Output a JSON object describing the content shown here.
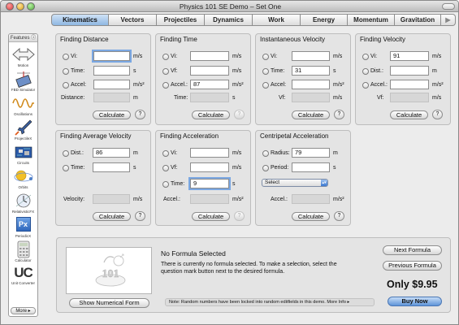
{
  "window": {
    "title": "Physics 101 SE Demo – Set One"
  },
  "tabs": [
    {
      "label": "Kinematics",
      "active": true
    },
    {
      "label": "Vectors"
    },
    {
      "label": "Projectiles"
    },
    {
      "label": "Dynamics"
    },
    {
      "label": "Work"
    },
    {
      "label": "Energy"
    },
    {
      "label": "Momentum"
    },
    {
      "label": "Gravitation"
    }
  ],
  "tab_scroll_glyph": "▶",
  "sidebar": {
    "header": "Features ⓘ",
    "items": [
      {
        "label": "Motion",
        "icon": "motion-arrows-icon"
      },
      {
        "label": "FBD Simulator",
        "icon": "fbd-simulator-icon"
      },
      {
        "label": "Oscillations",
        "icon": "oscillations-icon"
      },
      {
        "label": "ProjectileX",
        "icon": "rocket-icon"
      },
      {
        "label": "Circuits",
        "icon": "circuit-board-icon"
      },
      {
        "label": "Orbits",
        "icon": "orbits-icon"
      },
      {
        "label": "RelativisticFX",
        "icon": "relativistic-icon"
      },
      {
        "label": "PeriodicX",
        "icon": "periodic-icon",
        "badge": "Px"
      },
      {
        "label": "Calculator",
        "icon": "calculator-icon"
      },
      {
        "label": "Unit Converter",
        "icon": "unit-converter-icon",
        "badge": "UC"
      }
    ],
    "more": "More ▸"
  },
  "panels": {
    "finding_distance": {
      "title": "Finding Distance",
      "vi": {
        "label": "Vi:",
        "value": "",
        "unit": "m/s"
      },
      "time": {
        "label": "Time:",
        "value": "",
        "unit": "s"
      },
      "accel": {
        "label": "Accel:",
        "value": "",
        "unit": "m/s²"
      },
      "result": {
        "label": "Distance:",
        "value": "",
        "unit": "m"
      },
      "calculate": "Calculate",
      "help": "?"
    },
    "finding_time": {
      "title": "Finding Time",
      "vi": {
        "label": "Vi:",
        "value": "",
        "unit": "m/s"
      },
      "vf": {
        "label": "Vf:",
        "value": "",
        "unit": "m/s"
      },
      "accel": {
        "label": "Accel.:",
        "value": "87",
        "unit": "m/s²"
      },
      "result": {
        "label": "Time:",
        "value": "",
        "unit": "s"
      },
      "calculate": "Calculate",
      "help": "?"
    },
    "instantaneous_velocity": {
      "title": "Instantaneous Velocity",
      "vi": {
        "label": "Vi:",
        "value": "",
        "unit": "m/s"
      },
      "time": {
        "label": "Time:",
        "value": "31",
        "unit": "s"
      },
      "accel": {
        "label": "Accel:",
        "value": "",
        "unit": "m/s²"
      },
      "result": {
        "label": "Vf:",
        "value": "",
        "unit": "m/s"
      },
      "calculate": "Calculate",
      "help": "?"
    },
    "finding_velocity": {
      "title": "Finding Velocity",
      "vi": {
        "label": "Vi:",
        "value": "91",
        "unit": "m/s"
      },
      "dist": {
        "label": "Dist.:",
        "value": "",
        "unit": "m"
      },
      "accel": {
        "label": "Accel.:",
        "value": "",
        "unit": "m/s²"
      },
      "result": {
        "label": "Vf:",
        "value": "",
        "unit": "m/s"
      },
      "calculate": "Calculate",
      "help": "?"
    },
    "finding_average_velocity": {
      "title": "Finding Average Velocity",
      "dist": {
        "label": "Dist.:",
        "value": "86",
        "unit": "m"
      },
      "time": {
        "label": "Time:",
        "value": "",
        "unit": "s"
      },
      "result": {
        "label": "Velocity:",
        "value": "",
        "unit": "m/s"
      },
      "calculate": "Calculate",
      "help": "?"
    },
    "finding_acceleration": {
      "title": "Finding Acceleration",
      "vi": {
        "label": "Vi:",
        "value": "",
        "unit": "m/s"
      },
      "vf": {
        "label": "Vf:",
        "value": "",
        "unit": "m/s"
      },
      "time": {
        "label": "Time:",
        "value": "9",
        "unit": "s"
      },
      "result": {
        "label": "Accel.:",
        "value": "",
        "unit": "m/s²"
      },
      "calculate": "Calculate",
      "help": "?"
    },
    "centripetal_acceleration": {
      "title": "Centripetal Acceleration",
      "radius": {
        "label": "Radius:",
        "value": "79",
        "unit": "m"
      },
      "period": {
        "label": "Period:",
        "value": "",
        "unit": "s"
      },
      "select": {
        "value": "Select"
      },
      "result": {
        "label": "Accel.:",
        "value": "",
        "unit": "m/s²"
      },
      "calculate": "Calculate",
      "help": "?"
    }
  },
  "bottom": {
    "logo_text": "101",
    "formula_title": "No Formula Selected",
    "formula_desc": "There is currently no formula selected. To make a selection, select the question mark button next to the desired formula.",
    "show_numerical": "Show Numerical Form",
    "note": "Note: Random numbers have been locked into random editfields in this demo. More Info ▸",
    "next_formula": "Next Formula",
    "previous_formula": "Previous Formula",
    "price": "Only $9.95",
    "buy_now": "Buy Now"
  },
  "colors": {
    "accent": "#6a9fe0",
    "panel_bg": "#e4e4e4",
    "window_bg": "#ececec"
  }
}
